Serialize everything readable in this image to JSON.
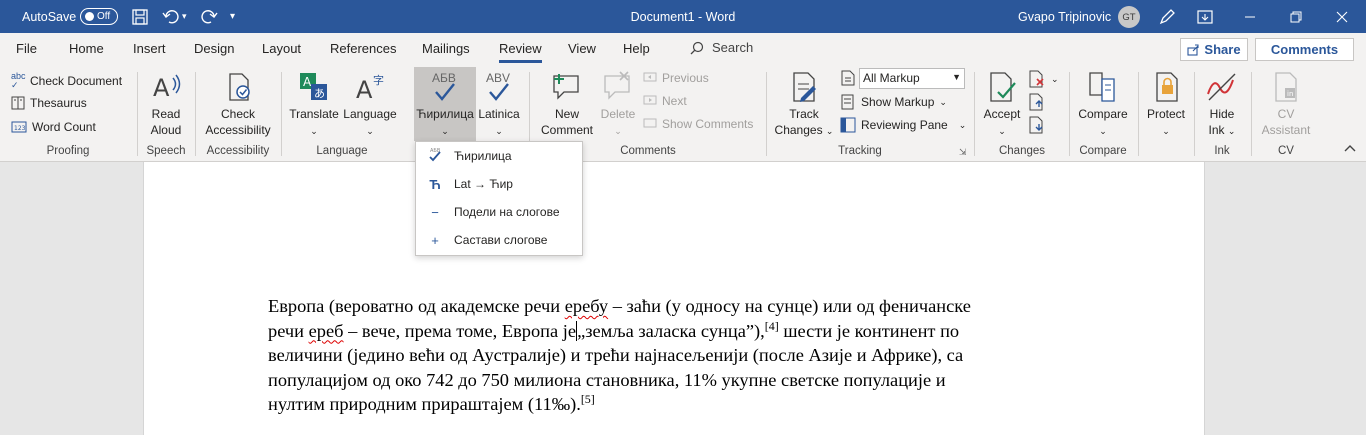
{
  "titlebar": {
    "autosave_label": "AutoSave",
    "autosave_state": "Off",
    "document_title": "Document1  -  Word",
    "user_name": "Gvapo Tripinovic",
    "user_initials": "GT"
  },
  "menu": {
    "tabs": [
      "File",
      "Home",
      "Insert",
      "Design",
      "Layout",
      "References",
      "Mailings",
      "Review",
      "View",
      "Help"
    ],
    "active_tab": "Review",
    "search_label": "Search",
    "share_label": "Share",
    "comments_label": "Comments"
  },
  "ribbon": {
    "proofing": {
      "label": "Proofing",
      "check_document": "Check Document",
      "thesaurus": "Thesaurus",
      "word_count": "Word Count"
    },
    "speech": {
      "label": "Speech",
      "read_aloud_1": "Read",
      "read_aloud_2": "Aloud"
    },
    "accessibility": {
      "label": "Accessibility",
      "check_1": "Check",
      "check_2": "Accessibility"
    },
    "language": {
      "label": "Language",
      "translate": "Translate",
      "language": "Language"
    },
    "cyrillic": {
      "cyrillic_label": "Ћирилица",
      "cyrillic_glyph": "АБВ",
      "latin_label": "Latinica",
      "latin_glyph": "ABV"
    },
    "comments": {
      "label": "Comments",
      "new_1": "New",
      "new_2": "Comment",
      "delete": "Delete",
      "previous": "Previous",
      "next": "Next",
      "show_comments": "Show Comments"
    },
    "tracking": {
      "label": "Tracking",
      "track_1": "Track",
      "track_2": "Changes",
      "markup_select": "All Markup",
      "show_markup": "Show Markup",
      "reviewing_pane": "Reviewing Pane"
    },
    "changes": {
      "label": "Changes",
      "accept": "Accept"
    },
    "compare": {
      "label": "Compare",
      "compare": "Compare"
    },
    "protect": {
      "label": "",
      "protect": "Protect"
    },
    "ink": {
      "label": "Ink",
      "hide_1": "Hide",
      "hide_2": "Ink"
    },
    "cv": {
      "label": "CV",
      "cv_1": "CV",
      "cv_2": "Assistant"
    }
  },
  "dropdown": {
    "items": [
      {
        "label": "Ћирилица",
        "icon": "check-cyrillic-icon"
      },
      {
        "label": "Lat → Ћир",
        "icon": "cyrillic-letter-icon"
      },
      {
        "label": "Подели на слогове",
        "icon": "minus-icon"
      },
      {
        "label": "Састави слогове",
        "icon": "plus-icon"
      }
    ]
  },
  "document": {
    "line1_a": "Европа (вероватно од академске речи ",
    "line1_b": "еребу",
    "line1_c": " – заћи (у односу на сунце) или од феничанске",
    "line2_a": "речи ",
    "line2_b": "ереб",
    "line2_c": " – вече, према томе, Европа је",
    "line2_d": "„земља заласка сунца”),",
    "ref4": "[4]",
    "line2_e": " шести је континент по",
    "line3": "величини (једино већи од Аустралије) и трећи најнасељенији (после Азије и Африке), са",
    "line4": "популацијом од око 742 до 750 милиона становника, 11% укупне светске популације и",
    "line5": "нултим природним прираштајем (11‰).",
    "ref5": "[5]"
  },
  "colors": {
    "title_bar": "#2b579a",
    "accent": "#2b579a",
    "ribbon_bg": "#f3f2f1",
    "pressed_bg": "#c8c6c4"
  }
}
